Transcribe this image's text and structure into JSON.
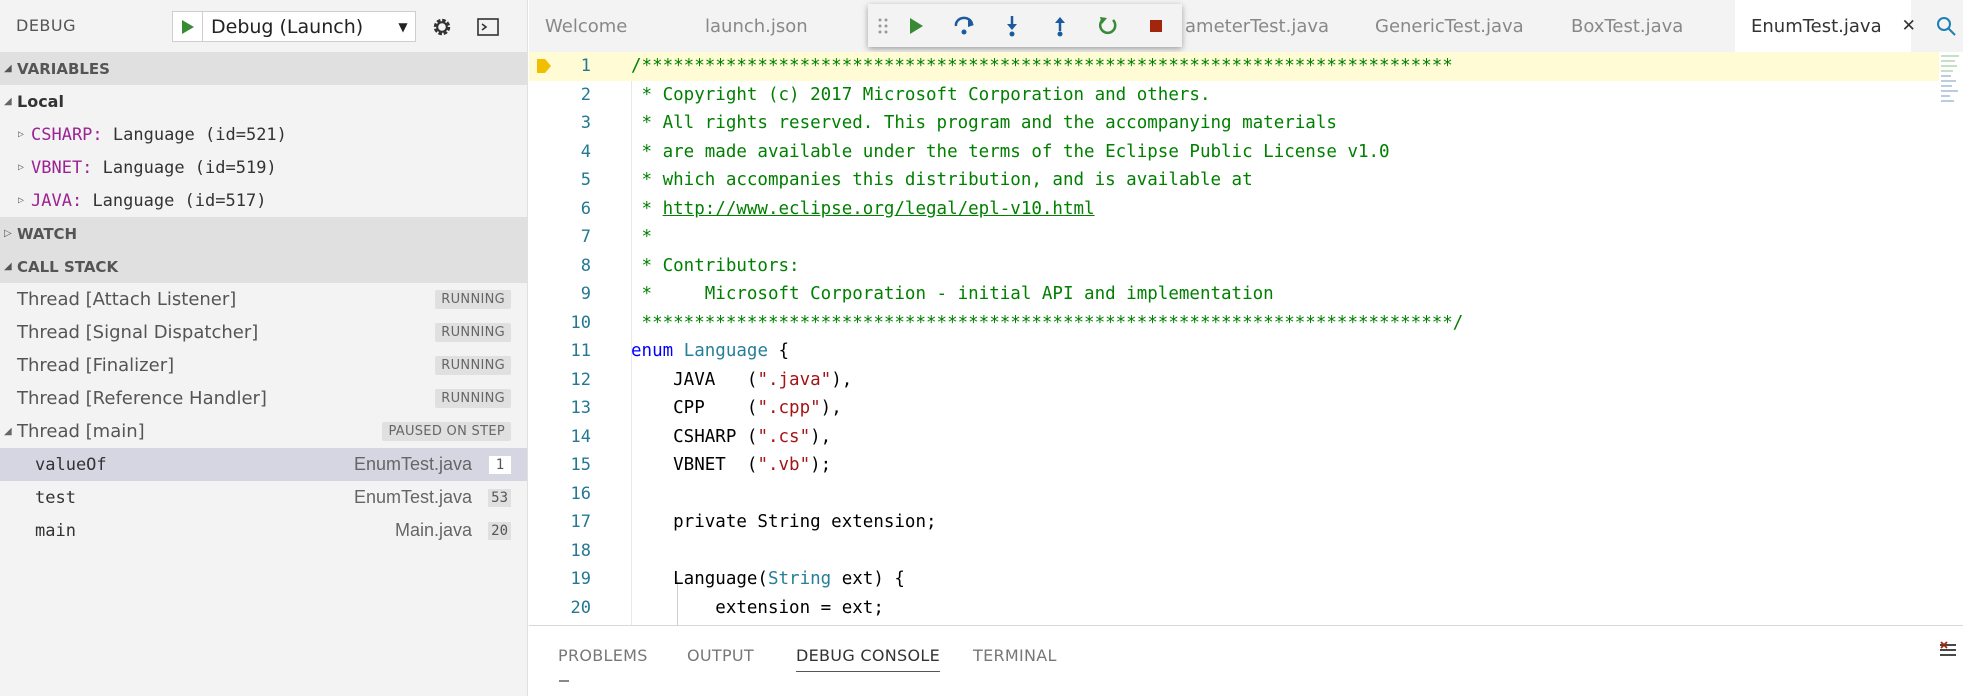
{
  "debug_toolbar": {
    "title": "DEBUG",
    "config_label": "Debug (Launch)"
  },
  "sections": {
    "variables": "VARIABLES",
    "local": "Local",
    "watch": "WATCH",
    "call_stack": "CALL STACK"
  },
  "variables": [
    {
      "name": "CSHARP:",
      "value": "Language (id=521)"
    },
    {
      "name": "VBNET:",
      "value": "Language (id=519)"
    },
    {
      "name": "JAVA:",
      "value": "Language (id=517)"
    }
  ],
  "threads": [
    {
      "name": "Thread [Attach Listener]",
      "status": "RUNNING"
    },
    {
      "name": "Thread [Signal Dispatcher]",
      "status": "RUNNING"
    },
    {
      "name": "Thread [Finalizer]",
      "status": "RUNNING"
    },
    {
      "name": "Thread [Reference Handler]",
      "status": "RUNNING"
    }
  ],
  "main_thread": {
    "name": "Thread [main]",
    "status": "PAUSED ON STEP"
  },
  "frames": [
    {
      "method": "valueOf",
      "file": "EnumTest.java",
      "line": "1"
    },
    {
      "method": "test",
      "file": "EnumTest.java",
      "line": "53"
    },
    {
      "method": "main",
      "file": "Main.java",
      "line": "20"
    }
  ],
  "tabs": [
    "Welcome",
    "launch.json",
    "ameterTest.java",
    "GenericTest.java",
    "BoxTest.java",
    "EnumTest.java"
  ],
  "active_tab": "EnumTest.java",
  "code": {
    "l1": "/*****************************************************************************",
    "l2": " * Copyright (c) 2017 Microsoft Corporation and others.",
    "l3": " * All rights reserved. This program and the accompanying materials",
    "l4": " * are made available under the terms of the Eclipse Public License v1.0",
    "l5": " * which accompanies this distribution, and is available at",
    "l6a": " * ",
    "l6b": "http://www.eclipse.org/legal/epl-v10.html",
    "l7": " *",
    "l8": " * Contributors:",
    "l9": " *     Microsoft Corporation - initial API and implementation",
    "l10": " *****************************************************************************/",
    "l11a": "enum",
    "l11b": "Language",
    "l11c": " {",
    "l12a": "    JAVA   (",
    "l12b": "\".java\"",
    "l12c": "),",
    "l13a": "    CPP    (",
    "l13b": "\".cpp\"",
    "l13c": "),",
    "l14a": "    CSHARP (",
    "l14b": "\".cs\"",
    "l14c": "),",
    "l15a": "    VBNET  (",
    "l15b": "\".vb\"",
    "l15c": ");",
    "l17": "    private String extension;",
    "l19a": "    Language(",
    "l19b": "String",
    "l19c": " ext) {",
    "l20": "        extension = ext;"
  },
  "line_numbers": [
    "1",
    "2",
    "3",
    "4",
    "5",
    "6",
    "7",
    "8",
    "9",
    "10",
    "11",
    "12",
    "13",
    "14",
    "15",
    "16",
    "17",
    "18",
    "19",
    "20"
  ],
  "panel_tabs": [
    "PROBLEMS",
    "OUTPUT",
    "DEBUG CONSOLE",
    "TERMINAL"
  ],
  "colors": {
    "accent_green": "#388a34",
    "stop_red": "#a1260d",
    "current_line": "#fefbd5",
    "var_name": "#9b2393"
  }
}
